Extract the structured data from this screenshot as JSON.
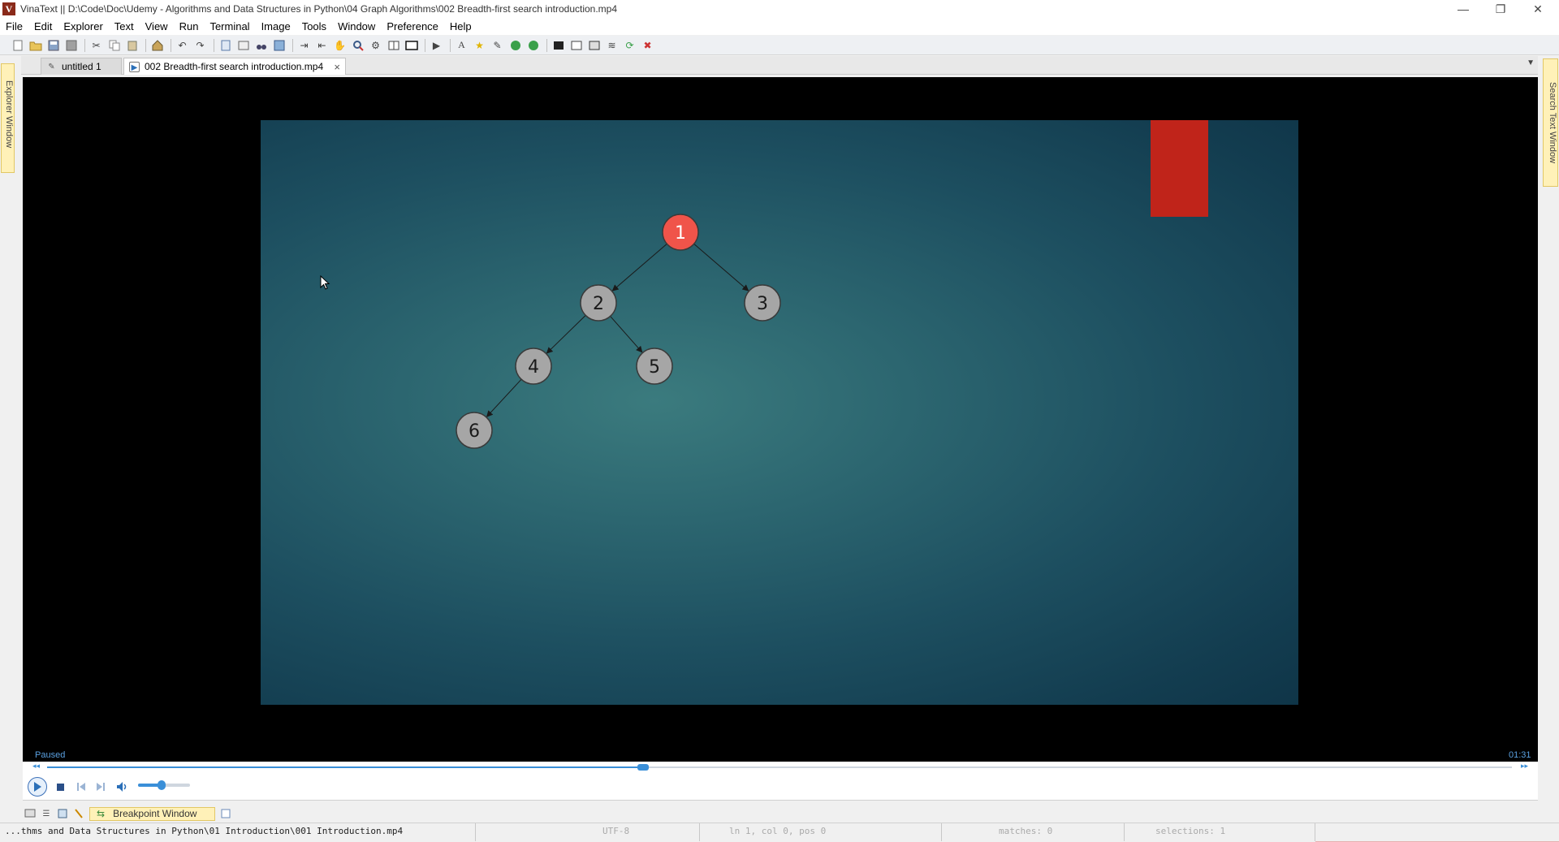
{
  "window": {
    "app_icon_letter": "V",
    "title": "VinaText || D:\\Code\\Doc\\Udemy - Algorithms and Data Structures in Python\\04 Graph Algorithms\\002 Breadth-first search introduction.mp4",
    "minimize": "—",
    "restore": "❐",
    "close": "✕"
  },
  "menu": [
    "File",
    "Edit",
    "Explorer",
    "Text",
    "View",
    "Run",
    "Terminal",
    "Image",
    "Tools",
    "Window",
    "Preference",
    "Help"
  ],
  "side_panels": {
    "left_label": "Explorer Window",
    "right_label": "Search Text Window"
  },
  "tabs": [
    {
      "label": "untitled 1",
      "icon": "pencil-icon",
      "active": false
    },
    {
      "label": "002 Breadth-first search introduction.mp4",
      "icon": "media-play-icon",
      "active": true
    }
  ],
  "tab_close": "×",
  "tab_dropdown": "▼",
  "video": {
    "status": "Paused",
    "time": "01:31",
    "progress": 0.407,
    "volume": 0.45,
    "graph": {
      "nodes": [
        {
          "id": "1",
          "highlighted": true
        },
        {
          "id": "2",
          "highlighted": false
        },
        {
          "id": "3",
          "highlighted": false
        },
        {
          "id": "4",
          "highlighted": false
        },
        {
          "id": "5",
          "highlighted": false
        },
        {
          "id": "6",
          "highlighted": false
        }
      ],
      "edges": [
        [
          "1",
          "2"
        ],
        [
          "1",
          "3"
        ],
        [
          "2",
          "4"
        ],
        [
          "2",
          "5"
        ],
        [
          "4",
          "6"
        ]
      ]
    },
    "colors": {
      "highlight_node": "#f0544a",
      "normal_node": "#a6a6a6",
      "red_block": "#c0241a"
    }
  },
  "controls": {
    "seek_back": "◂◂",
    "seek_forward": "▸▸"
  },
  "bottom_panel": {
    "breakpoint_tab": "Breakpoint Window"
  },
  "statusbar": {
    "path": "...thms and Data Structures in Python\\01 Introduction\\001 Introduction.mp4",
    "encoding": "UTF-8",
    "position": "ln 1, col 0, pos 0",
    "matches": "matches: 0",
    "selections": "selections: 1"
  }
}
